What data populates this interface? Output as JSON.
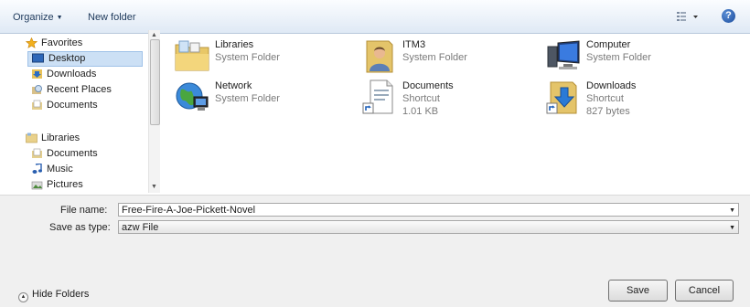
{
  "toolbar": {
    "organize_label": "Organize",
    "new_folder_label": "New folder",
    "help_label": "?"
  },
  "nav": {
    "favorites_header": "Favorites",
    "favorites": [
      {
        "label": "Desktop",
        "icon": "desktop-icon",
        "selected": true
      },
      {
        "label": "Downloads",
        "icon": "downloads-icon"
      },
      {
        "label": "Recent Places",
        "icon": "recent-places-icon"
      },
      {
        "label": "Documents",
        "icon": "documents-icon"
      }
    ],
    "libraries_header": "Libraries",
    "libraries": [
      {
        "label": "Documents",
        "icon": "documents-icon"
      },
      {
        "label": "Music",
        "icon": "music-icon"
      },
      {
        "label": "Pictures",
        "icon": "pictures-icon"
      }
    ]
  },
  "items": [
    {
      "name": "Libraries",
      "line1": "System Folder",
      "icon": "libraries-folder-icon"
    },
    {
      "name": "ITM3",
      "line1": "System Folder",
      "icon": "user-folder-icon"
    },
    {
      "name": "Computer",
      "line1": "System Folder",
      "icon": "computer-icon"
    },
    {
      "name": "Network",
      "line1": "System Folder",
      "icon": "network-icon"
    },
    {
      "name": "Documents",
      "line1": "Shortcut",
      "line2": "1.01 KB",
      "icon": "documents-shortcut-icon"
    },
    {
      "name": "Downloads",
      "line1": "Shortcut",
      "line2": "827 bytes",
      "icon": "downloads-shortcut-icon"
    }
  ],
  "form": {
    "file_name_label": "File name:",
    "file_name_value": "Free-Fire-A-Joe-Pickett-Novel",
    "save_type_label": "Save as type:",
    "save_type_value": "azw File"
  },
  "footer": {
    "hide_folders_label": "Hide Folders",
    "save_label": "Save",
    "cancel_label": "Cancel"
  }
}
